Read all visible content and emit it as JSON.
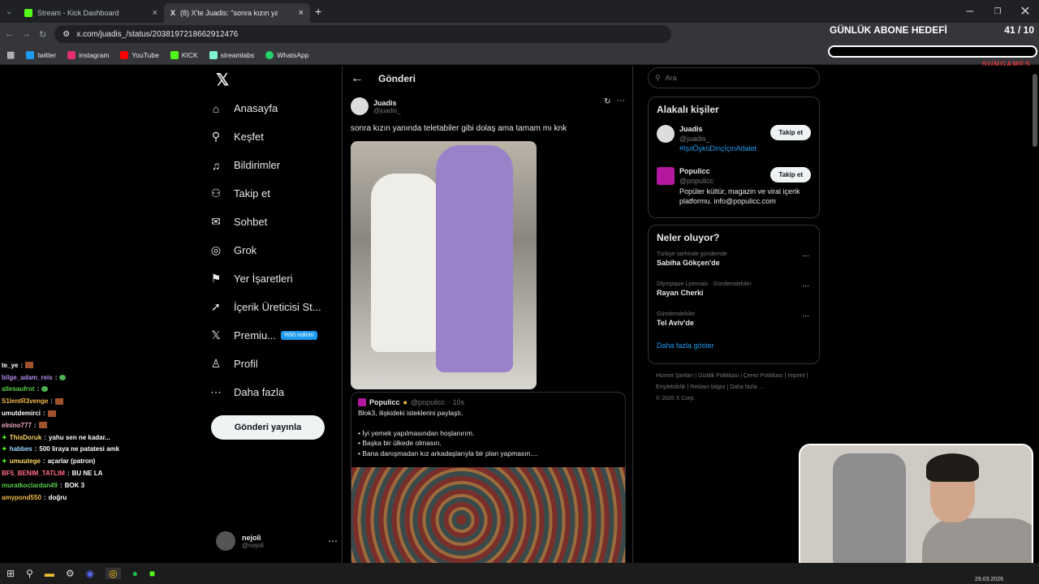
{
  "browser": {
    "tabs": [
      {
        "label": "Stream - Kick Dashboard",
        "icon": "kick-icon",
        "color": "#53fc18"
      },
      {
        "label": "(8) X'te Juadis: \"sonra kızın yanı",
        "icon": "x-icon",
        "color": "#ffffff"
      }
    ],
    "url": "x.com/juadis_/status/2038197218662912476",
    "bookmarks": [
      {
        "label": "twitter",
        "color": "#1d9bf0"
      },
      {
        "label": "instagram",
        "color": "#e1306c"
      },
      {
        "label": "YouTube",
        "color": "#ff0000"
      },
      {
        "label": "KICK",
        "color": "#53fc18"
      },
      {
        "label": "streamlabs",
        "color": "#80f5d2"
      },
      {
        "label": "WhatsApp",
        "color": "#25d366"
      }
    ]
  },
  "overlay": {
    "goal_label": "GÜNLÜK ABONE HEDEFİ",
    "goal_count": "41 / 10",
    "brand": "SUNGAMES"
  },
  "nav": {
    "items": [
      {
        "label": "Anasayfa",
        "icon": "home-icon",
        "glyph": "⌂"
      },
      {
        "label": "Keşfet",
        "icon": "search-icon",
        "glyph": "⚲"
      },
      {
        "label": "Bildirimler",
        "icon": "bell-icon",
        "glyph": "♫"
      },
      {
        "label": "Takip et",
        "icon": "follow-icon",
        "glyph": "⚇"
      },
      {
        "label": "Sohbet",
        "icon": "mail-icon",
        "glyph": "✉"
      },
      {
        "label": "Grok",
        "icon": "grok-icon",
        "glyph": "◎"
      },
      {
        "label": "Yer İşaretleri",
        "icon": "bookmark-icon",
        "glyph": "⚑"
      },
      {
        "label": "İçerik Üreticisi St...",
        "icon": "rocket-icon",
        "glyph": "➚"
      },
      {
        "label": "Premiu...",
        "icon": "x-premium-icon",
        "glyph": "𝕏"
      },
      {
        "label": "Profil",
        "icon": "profile-icon",
        "glyph": "♙"
      },
      {
        "label": "Daha fazla",
        "icon": "more-icon",
        "glyph": "⋯"
      }
    ],
    "premium_badge": "%50 indirim",
    "post_button": "Gönderi yayınla",
    "account_name": "nejoli",
    "account_handle": "@nejoli"
  },
  "post": {
    "header": "Gönderi",
    "author": "Juadis",
    "handle": "@juadis_",
    "text": "sonra kızın yanında teletabiler gibi dolaş ama tamam mı knk",
    "quote": {
      "author": "Populicc",
      "handle": "@populicc",
      "time": "· 10s",
      "lines": [
        "Blok3, ilişkideki isteklerini paylaştı.",
        "",
        "• İyi yemek yapılmasından hoşlanırım.",
        "• Başka bir ülkede olmasın.",
        "• Bana danışmadan kız arkadaşlarıyla bir plan yapmasın...."
      ]
    }
  },
  "sidebar": {
    "search_placeholder": "Ara",
    "related_title": "Alakalı kişiler",
    "people": [
      {
        "name": "Juadis",
        "handle": "@juadis_",
        "bio": "#IşılÖyküDinçİçinAdalet",
        "follow": "Takip et"
      },
      {
        "name": "Populicc",
        "handle": "@populicc",
        "bio": "Popüler kültür, magazin ve viral içerik platformu. info@populicc.com",
        "follow": "Takip et"
      }
    ],
    "trends_title": "Neler oluyor?",
    "trends": [
      {
        "context": "Türkiye tarihinde gündemde",
        "name": "Sabiha Gökçen'de"
      },
      {
        "context": "Olympique Lyonnais · Gündemdekiler",
        "name": "Rayan Cherki"
      },
      {
        "context": "Gündemdekiler",
        "name": "Tel Aviv'de"
      }
    ],
    "show_more": "Daha fazla göster",
    "footer": [
      "Hizmet Şartları",
      "Gizlilik Politikası",
      "Çerez Politikası",
      "Imprint",
      "Erişilebilirlik",
      "Reklam bilgisi",
      "Daha fazla ...",
      "© 2026 X Corp."
    ]
  },
  "chat": [
    {
      "user": "te_ye",
      "msg": "",
      "color": "#ffffff",
      "badge": "emote"
    },
    {
      "user": "bilge_adam_reis",
      "msg": "",
      "color": "#b48cf0",
      "badge": "pepe"
    },
    {
      "user": "allesaufrot",
      "msg": "",
      "color": "#59c94d",
      "badge": "pepe"
    },
    {
      "user": "S1lentR3venge",
      "msg": "",
      "color": "#f2b84b",
      "badge": "emote"
    },
    {
      "user": "umutdemirci",
      "msg": "",
      "color": "#ffffff",
      "badge": "emote"
    },
    {
      "user": "elnino777",
      "msg": "",
      "color": "#f0a6c8",
      "badge": "emote"
    },
    {
      "user": "ThisDoruk",
      "msg": "yahu sen ne kadar...",
      "color": "#ffd866",
      "badge": "sub"
    },
    {
      "user": "habbes",
      "msg": "500 liraya ne patatesi amk",
      "color": "#9ad7ff",
      "badge": "sub"
    },
    {
      "user": "umuutege",
      "msg": "açarlar (patron)",
      "color": "#ffd866",
      "badge": "sub"
    },
    {
      "user": "BF5_BENIM_TATLIM",
      "msg": "BU NE LA",
      "color": "#ff6b81",
      "badge": ""
    },
    {
      "user": "muratkoclardan49",
      "msg": "BOK 3",
      "color": "#59c94d",
      "badge": ""
    },
    {
      "user": "amypond550",
      "msg": "doğru",
      "color": "#f2b84b",
      "badge": ""
    }
  ],
  "taskbar": {
    "date": "29.03.2026"
  }
}
